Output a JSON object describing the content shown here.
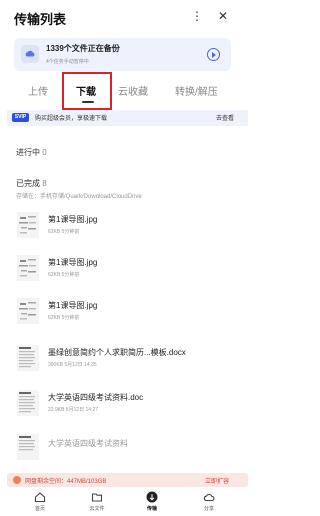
{
  "header": {
    "title": "传输列表",
    "menu_icon": "more-vertical-icon",
    "close_icon": "close-icon"
  },
  "backup": {
    "title": "1339个文件正在备份",
    "subtitle": "4个任务手动暂停中",
    "icon": "backup-cloud-icon",
    "action_icon": "play-circle-icon"
  },
  "tabs": [
    {
      "label": "上传",
      "active": false
    },
    {
      "label": "下载",
      "active": true
    },
    {
      "label": "云收藏",
      "active": false
    },
    {
      "label": "转换/解压",
      "active": false
    }
  ],
  "svip": {
    "badge": "SVIP",
    "text": "购买超级会员，享极速下载",
    "action": "去查看"
  },
  "sections": {
    "in_progress": {
      "label": "进行中",
      "count": "0"
    },
    "completed": {
      "label": "已完成",
      "count": "8"
    },
    "storage_path": "存储在：手机存储/Quark/Download/CloudDrive"
  },
  "files": [
    {
      "name": "第1课导图.jpg",
      "size": "62KB",
      "time": "5分钟前",
      "type": "image"
    },
    {
      "name": "第1课导图.jpg",
      "size": "62KB",
      "time": "5分钟前",
      "type": "image"
    },
    {
      "name": "第1课导图.jpg",
      "size": "62KB",
      "time": "5分钟前",
      "type": "image"
    },
    {
      "name": "墨绿创意简约个人求职简历...模板.docx",
      "size": "390KB",
      "time": "5月12日 14:35",
      "type": "doc"
    },
    {
      "name": "大学英语四级考试资料.doc",
      "size": "22.9KB",
      "time": "5月12日 14:27",
      "type": "doc"
    },
    {
      "name": "大学英语四级考试资料",
      "size": "",
      "time": "",
      "type": "doc"
    }
  ],
  "storage_warning": {
    "text": "网盘剩余空间：447MB/103GB",
    "action": "立即扩容",
    "icon": "warning-icon"
  },
  "bottom_nav": [
    {
      "label": "首页",
      "icon": "home-icon",
      "active": false
    },
    {
      "label": "云文件",
      "icon": "folder-icon",
      "active": false
    },
    {
      "label": "传输",
      "icon": "transfer-icon",
      "active": true
    },
    {
      "label": "分享",
      "icon": "share-cloud-icon",
      "active": false
    }
  ],
  "colors": {
    "accent": "#4a63e7",
    "svip": "#2f4fd8",
    "highlight_box": "#e01f2c",
    "warning_bg": "#fbe7e2",
    "warning_text": "#d9433a"
  }
}
